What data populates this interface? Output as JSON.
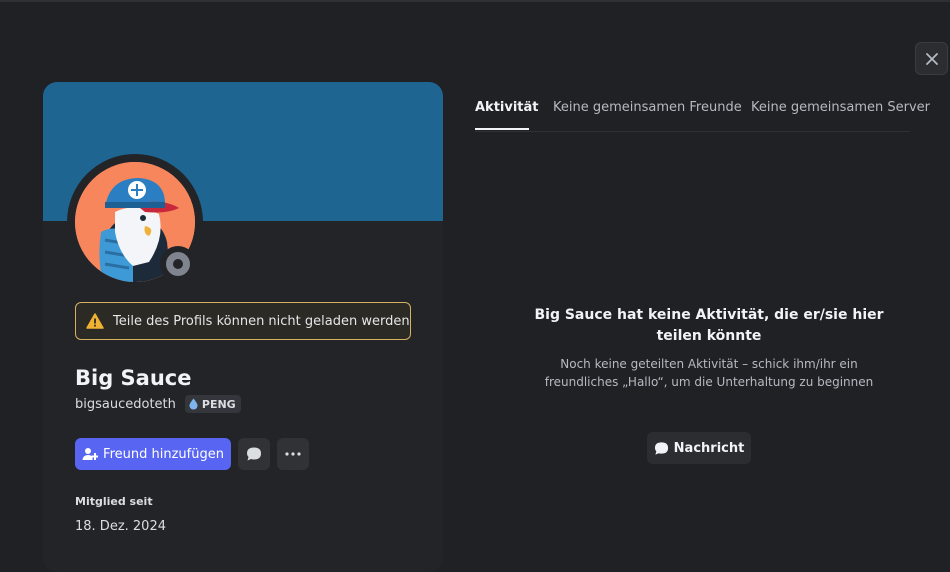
{
  "profile": {
    "display_name": "Big Sauce",
    "username": "bigsaucedoteth",
    "tag": "PENG",
    "warning": "Teile des Profils können nicht geladen werden",
    "add_friend_label": "Freund hinzufügen",
    "member_since_label": "Mitglied seit",
    "member_since_date": "18. Dez. 2024",
    "banner_color": "#1e6591",
    "avatar_bg": "#f7865d",
    "status": "offline"
  },
  "tabs": [
    {
      "label": "Aktivität",
      "active": true
    },
    {
      "label": "Keine gemeinsamen Freunde",
      "active": false
    },
    {
      "label": "Keine gemeinsamen Server",
      "active": false
    }
  ],
  "empty_state": {
    "title": "Big Sauce hat keine Aktivität, die er/sie hier teilen könnte",
    "subtitle": "Noch keine geteilten Aktivität – schick ihm/ihr ein freundliches „Hallo“, um die Unterhaltung zu beginnen",
    "button_label": "Nachricht"
  },
  "colors": {
    "accent": "#5865f2",
    "warning_border": "#d7b162",
    "background": "#1f2125",
    "card": "#232428"
  },
  "icons": [
    "close-icon",
    "warning-icon",
    "drop-icon",
    "add-user-icon",
    "chat-bubble-icon",
    "more-icon"
  ]
}
